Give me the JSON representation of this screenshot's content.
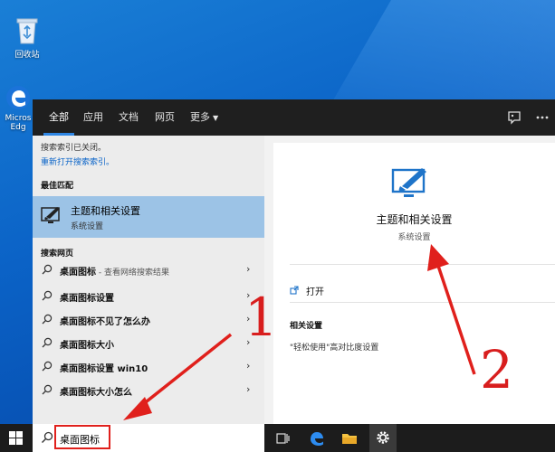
{
  "desktop": {
    "recycle_bin_label": "回收站",
    "edge_label_line1": "Micros",
    "edge_label_line2": "Edg"
  },
  "topbar": {
    "tabs": [
      {
        "label": "全部",
        "active": true
      },
      {
        "label": "应用"
      },
      {
        "label": "文档"
      },
      {
        "label": "网页"
      },
      {
        "label": "更多"
      }
    ]
  },
  "left": {
    "index_notice": "搜索索引已关闭。",
    "index_link": "重新打开搜索索引。",
    "best_match_header": "最佳匹配",
    "best_match": {
      "title": "主题和相关设置",
      "subtitle": "系统设置",
      "icon": "theme-brush-icon"
    },
    "web_header": "搜索网页",
    "results": [
      {
        "text": "桌面图标",
        "suffix": " - 查看网络搜索结果"
      },
      {
        "text": "桌面图标设置",
        "suffix": ""
      },
      {
        "text": "桌面图标不见了怎么办",
        "suffix": ""
      },
      {
        "text": "桌面图标大小",
        "suffix": ""
      },
      {
        "text": "桌面图标设置 win10",
        "suffix": ""
      },
      {
        "text": "桌面图标大小怎么",
        "suffix": ""
      }
    ]
  },
  "right": {
    "title": "主题和相关设置",
    "subtitle": "系统设置",
    "open_label": "打开",
    "related_header": "相关设置",
    "related_link": "\"轻松使用\"高对比度设置"
  },
  "taskbar": {
    "search_value": "桌面图标"
  },
  "annotations": {
    "label1": "1",
    "label2": "2",
    "color": "#d81e1e"
  },
  "colors": {
    "accent": "#2f86e3",
    "highlight": "#9cc3e6",
    "annotation_red": "#e0201c"
  }
}
